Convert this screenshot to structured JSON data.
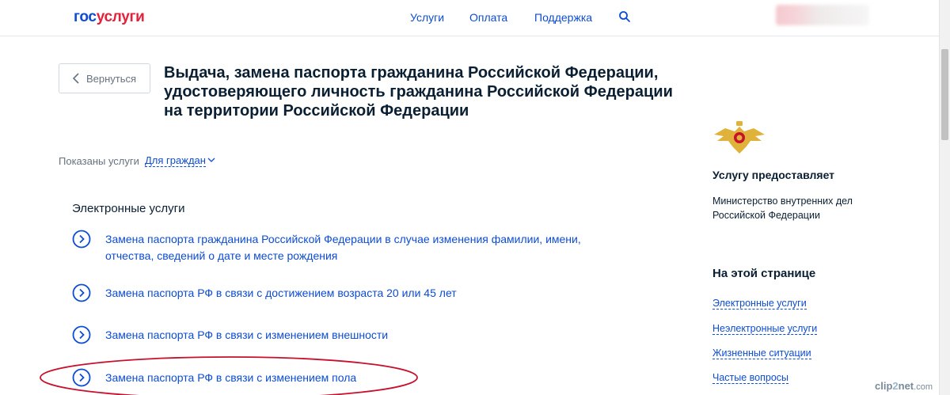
{
  "header": {
    "logo_part1": "гос",
    "logo_part2": "услуги",
    "nav": [
      "Услуги",
      "Оплата",
      "Поддержка"
    ]
  },
  "back_button": {
    "label": "Вернуться"
  },
  "page": {
    "title": "Выдача, замена паспорта гражданина Российской Федерации, удостоверяющего личность гражданина Российской Федерации на территории Российской Федерации"
  },
  "filter": {
    "label": "Показаны услуги",
    "value": "Для граждан"
  },
  "electronic": {
    "title": "Электронные услуги",
    "items": [
      "Замена паспорта гражданина Российской Федерации в случае изменения фамилии, имени, отчества, сведений о дате и месте рождения",
      "Замена паспорта РФ в связи с достижением возраста 20 или 45 лет",
      "Замена паспорта РФ в связи с изменением внешности",
      "Замена паспорта РФ в связи с изменением пола"
    ]
  },
  "sidebar": {
    "provider_label": "Услугу предоставляет",
    "provider_name": "Министерство внутренних дел Российской Федерации",
    "on_page_title": "На этой странице",
    "on_page_links": [
      "Электронные услуги",
      "Неэлектронные услуги",
      "Жизненные ситуации",
      "Частые вопросы"
    ]
  },
  "watermark": {
    "part1": "clip",
    "part2": "2",
    "part3": "net",
    "suffix": ".com"
  },
  "colors": {
    "link": "#0d4cd3",
    "logo_red": "#e5203a",
    "highlight": "#c8102e"
  }
}
